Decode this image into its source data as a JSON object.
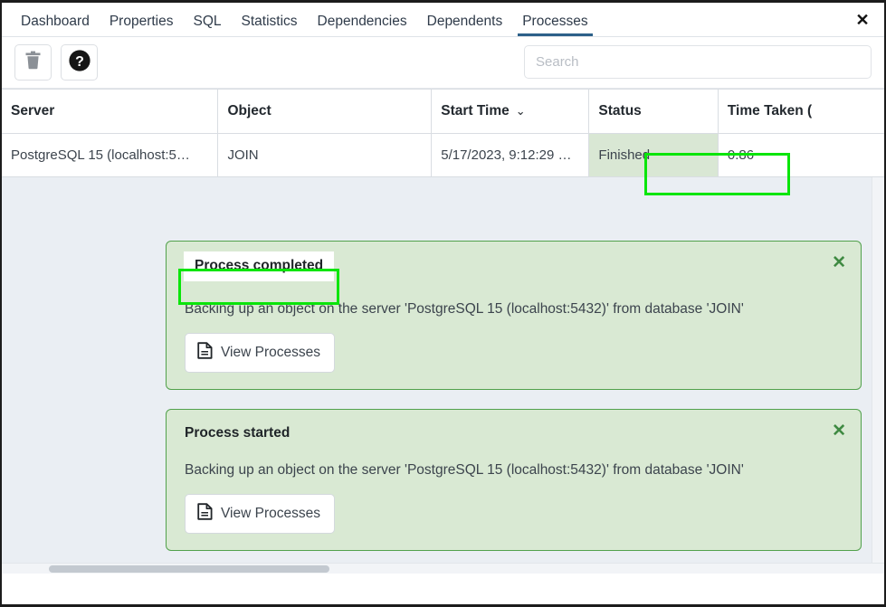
{
  "tabs": [
    {
      "label": "Dashboard",
      "active": false
    },
    {
      "label": "Properties",
      "active": false
    },
    {
      "label": "SQL",
      "active": false
    },
    {
      "label": "Statistics",
      "active": false
    },
    {
      "label": "Dependencies",
      "active": false
    },
    {
      "label": "Dependents",
      "active": false
    },
    {
      "label": "Processes",
      "active": true
    }
  ],
  "tab_close_label": "✕",
  "toolbar": {
    "delete_icon": "trash-icon",
    "help_icon": "help-icon",
    "help_glyph": "?"
  },
  "search": {
    "placeholder": "Search",
    "value": ""
  },
  "table": {
    "columns": [
      {
        "label": "Server",
        "sorted": false
      },
      {
        "label": "Object",
        "sorted": false
      },
      {
        "label": "Start Time",
        "sorted": true,
        "sort_caret": "⌄"
      },
      {
        "label": "Status",
        "sorted": false
      },
      {
        "label": "Time Taken (",
        "sorted": false
      }
    ],
    "rows": [
      {
        "server": "PostgreSQL 15 (localhost:5…",
        "object": "JOIN",
        "start_time": "5/17/2023, 9:12:29 …",
        "status": "Finished",
        "time_taken": "0.86"
      }
    ]
  },
  "alerts": [
    {
      "title": "Process completed",
      "highlighted": true,
      "message": "Backing up an object on the server 'PostgreSQL 15 (localhost:5432)' from database 'JOIN'",
      "button_label": "View Processes",
      "button_icon": "document-icon",
      "close_label": "✕"
    },
    {
      "title": "Process started",
      "highlighted": false,
      "message": "Backing up an object on the server 'PostgreSQL 15 (localhost:5432)' from database 'JOIN'",
      "button_label": "View Processes",
      "button_icon": "document-icon",
      "close_label": "✕"
    }
  ],
  "colors": {
    "active_tab_underline": "#2c6089",
    "annotation_green": "#0ae50a",
    "alert_background": "#d9e9d3",
    "alert_border": "#52a14c",
    "status_cell_background": "#d9e7d4",
    "page_background": "#eaeef3"
  }
}
